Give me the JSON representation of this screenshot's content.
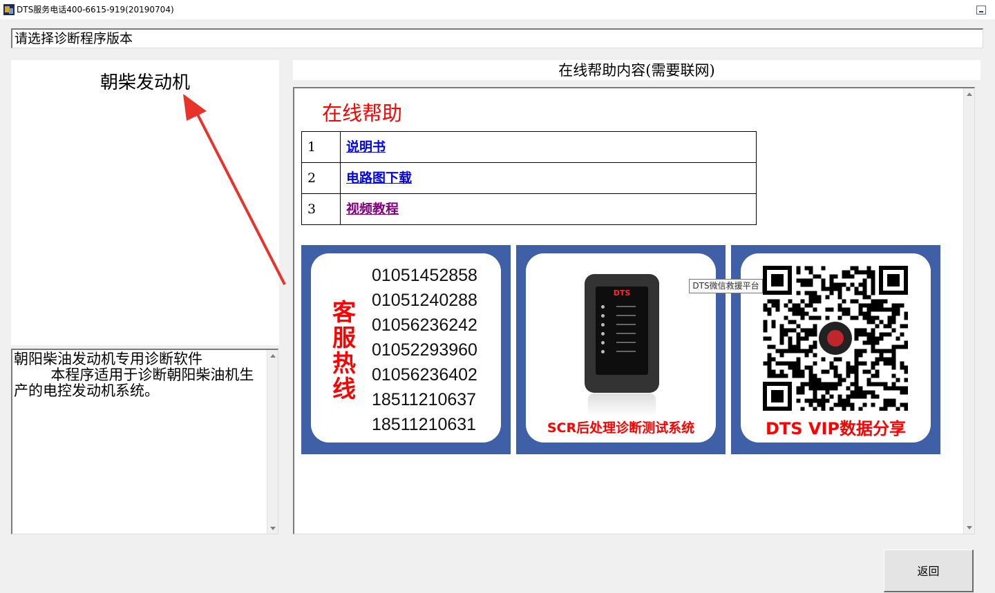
{
  "window": {
    "title": "DTS服务电话400-6615-919(20190704)"
  },
  "version_field": {
    "label": "请选择诊断程序版本"
  },
  "program": {
    "name": "朝柴发动机"
  },
  "description": {
    "text": "朝阳柴油发动机专用诊断软件\n        本程序适用于诊断朝阳柴油机生产的电控发动机系统。"
  },
  "help": {
    "header": "在线帮助内容(需要联网)",
    "title": "在线帮助",
    "links": [
      {
        "num": "1",
        "label": "说明书"
      },
      {
        "num": "2",
        "label": "电路图下载"
      },
      {
        "num": "3",
        "label": "视频教程"
      }
    ]
  },
  "banners": {
    "hotline": {
      "label": "客服热线",
      "phones": [
        "01051452858",
        "01051240288",
        "01056236242",
        "01052293960",
        "01056236402",
        "18511210637",
        "18511210631"
      ]
    },
    "scr": {
      "device_brand": "DTS",
      "label": "SCR后处理诊断测试系统"
    },
    "qr": {
      "label": "DTS VIP数据分享"
    }
  },
  "tooltip": {
    "text": "DTS微信救援平台"
  },
  "buttons": {
    "return_label": "返回"
  },
  "colors": {
    "accent_red": "#ff0000",
    "banner_blue": "#3f5fa6",
    "link_blue": "#0000ee",
    "link_visited": "#800080"
  }
}
